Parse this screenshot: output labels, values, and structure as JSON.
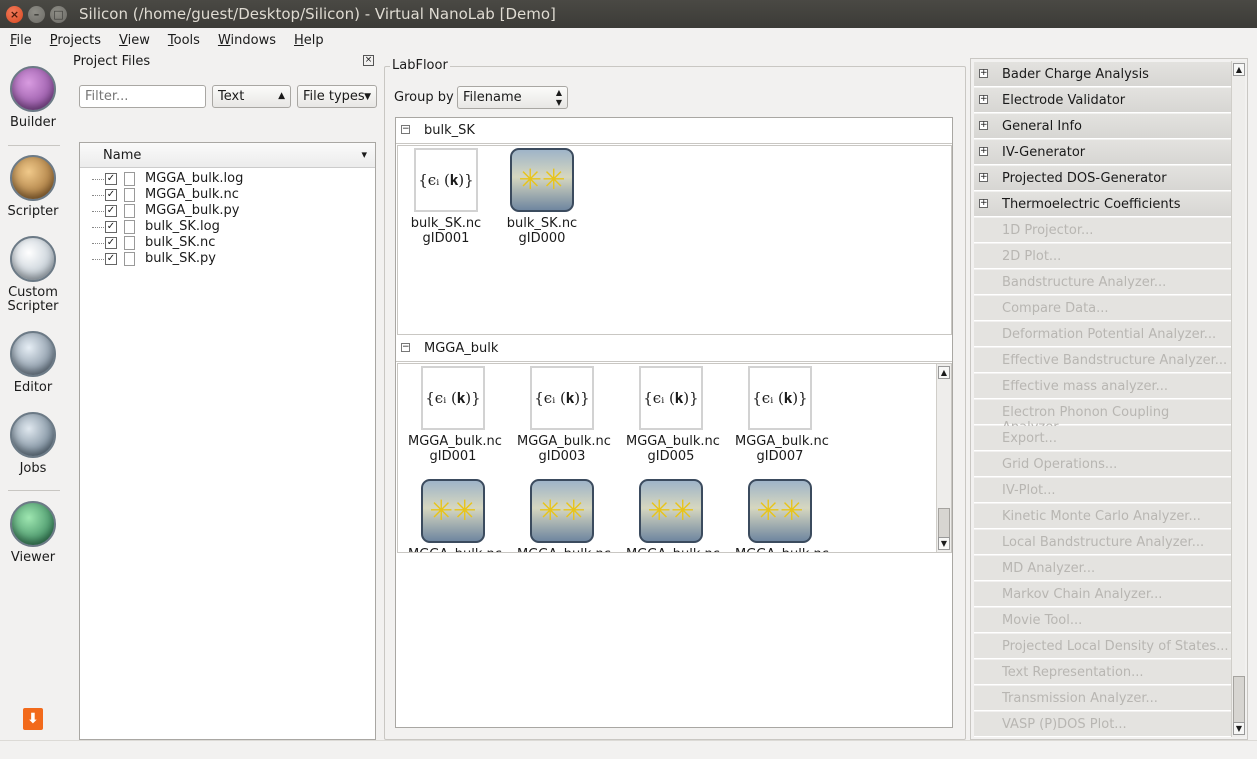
{
  "window": {
    "title": "Silicon (/home/guest/Desktop/Silicon) - Virtual NanoLab [Demo]"
  },
  "menubar": [
    {
      "label": "File",
      "mnemonic": "F",
      "rest": "ile"
    },
    {
      "label": "Projects",
      "mnemonic": "P",
      "rest": "rojects"
    },
    {
      "label": "View",
      "mnemonic": "V",
      "rest": "iew"
    },
    {
      "label": "Tools",
      "mnemonic": "T",
      "rest": "ools"
    },
    {
      "label": "Windows",
      "mnemonic": "W",
      "rest": "indows"
    },
    {
      "label": "Help",
      "mnemonic": "H",
      "rest": "elp"
    }
  ],
  "toolbar": {
    "builder": "Builder",
    "scripter": "Scripter",
    "custom_scripter_1": "Custom",
    "custom_scripter_2": "Scripter",
    "editor": "Editor",
    "jobs": "Jobs",
    "viewer": "Viewer"
  },
  "project_files": {
    "title": "Project Files",
    "filter_placeholder": "Filter...",
    "mode_select": "Text",
    "file_types": "File types",
    "column_header": "Name",
    "files": [
      "MGGA_bulk.log",
      "MGGA_bulk.nc",
      "MGGA_bulk.py",
      "bulk_SK.log",
      "bulk_SK.nc",
      "bulk_SK.py"
    ]
  },
  "labfloor": {
    "title": "LabFloor",
    "group_by_label": "Group by",
    "group_by_value": "Filename",
    "bulk_sk": {
      "name": "bulk_SK",
      "items": [
        {
          "file": "bulk_SK.nc",
          "id": "gID001",
          "kind": "eigen"
        },
        {
          "file": "bulk_SK.nc",
          "id": "gID000",
          "kind": "config"
        }
      ]
    },
    "mgga_bulk": {
      "name": "MGGA_bulk",
      "items": [
        {
          "file": "MGGA_bulk.nc",
          "id": "gID001",
          "kind": "eigen"
        },
        {
          "file": "MGGA_bulk.nc",
          "id": "gID003",
          "kind": "eigen"
        },
        {
          "file": "MGGA_bulk.nc",
          "id": "gID005",
          "kind": "eigen"
        },
        {
          "file": "MGGA_bulk.nc",
          "id": "gID007",
          "kind": "eigen"
        },
        {
          "file": "MGGA_bulk.nc",
          "id": "",
          "kind": "config"
        },
        {
          "file": "MGGA_bulk.nc",
          "id": "",
          "kind": "config"
        },
        {
          "file": "MGGA_bulk.nc",
          "id": "",
          "kind": "config"
        },
        {
          "file": "MGGA_bulk.nc",
          "id": "",
          "kind": "config"
        }
      ]
    }
  },
  "analyzers_enabled": [
    "Bader Charge Analysis",
    "Electrode Validator",
    "General Info",
    "IV-Generator",
    "Projected DOS-Generator",
    "Thermoelectric Coefficients"
  ],
  "analyzers_disabled": [
    "1D Projector...",
    "2D Plot...",
    "Bandstructure Analyzer...",
    "Compare Data...",
    "Deformation Potential Analyzer...",
    "Effective Bandstructure Analyzer...",
    "Effective mass analyzer...",
    "Electron Phonon Coupling Analyzer...",
    "Export...",
    "Grid Operations...",
    "IV-Plot...",
    "Kinetic Monte Carlo Analyzer...",
    "Local Bandstructure Analyzer...",
    "MD Analyzer...",
    "Markov Chain Analyzer...",
    "Movie Tool...",
    "Projected Local Density of States...",
    "Text Representation...",
    "Transmission Analyzer...",
    "VASP (P)DOS Plot..."
  ],
  "icons": {
    "eigen_label": "{ϵᵢ (𝐤)}"
  }
}
